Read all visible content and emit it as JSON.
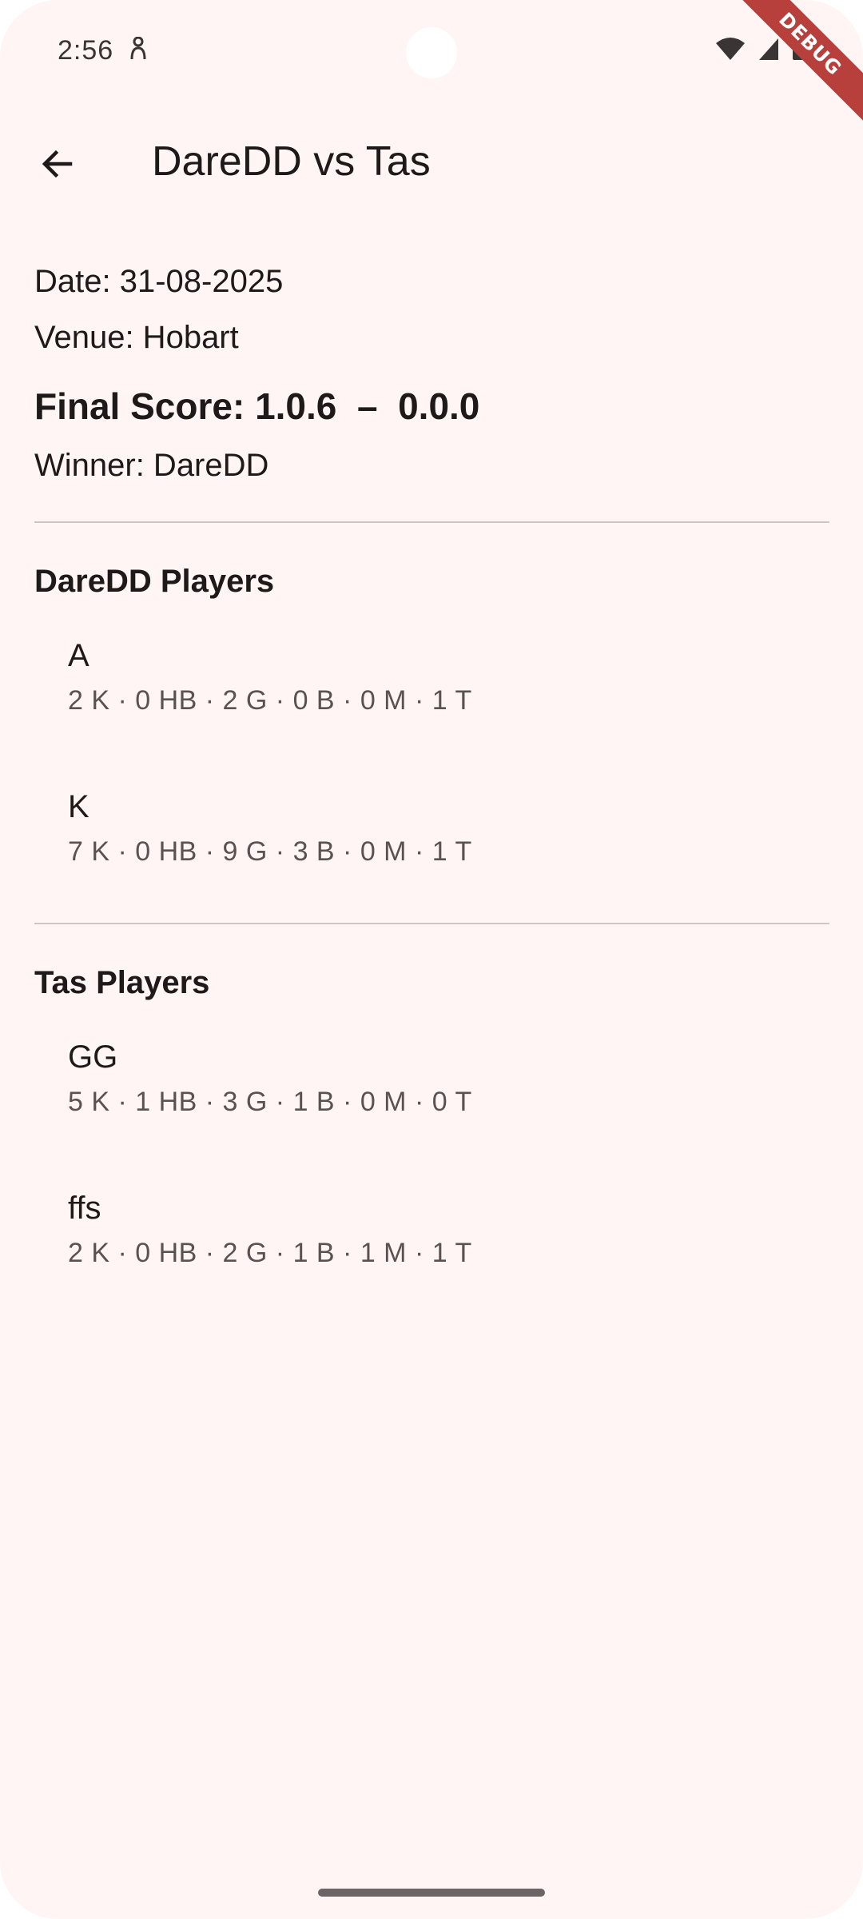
{
  "status_bar": {
    "time": "2:56",
    "icons": [
      "person-icon",
      "wifi-icon",
      "signal-icon",
      "battery-icon"
    ]
  },
  "debug_banner": "DEBUG",
  "app_bar": {
    "title": "DareDD vs Tas",
    "back_icon": "arrow-left-icon"
  },
  "match": {
    "date": "Date: 31-08-2025",
    "venue": "Venue: Hobart",
    "final_score": "Final Score: 1.0.6  –  0.0.0",
    "winner": "Winner: DareDD"
  },
  "teams": [
    {
      "heading": "DareDD Players",
      "players": [
        {
          "name": "A",
          "stats": "2 K · 0 HB · 2 G · 0 B · 0 M · 1 T"
        },
        {
          "name": "K",
          "stats": "7 K · 0 HB · 9 G · 3 B · 0 M · 1 T"
        }
      ]
    },
    {
      "heading": "Tas Players",
      "players": [
        {
          "name": "GG",
          "stats": "5 K · 1 HB · 3 G · 1 B · 0 M · 0 T"
        },
        {
          "name": "ffs",
          "stats": "2 K · 0 HB · 2 G · 1 B · 1 M · 1 T"
        }
      ]
    }
  ],
  "colors": {
    "background": "#fff5f4",
    "text_primary": "#1f1a1a",
    "text_secondary": "#5a5252",
    "divider": "#cfc6c6",
    "debug_banner": "#b8403c"
  }
}
